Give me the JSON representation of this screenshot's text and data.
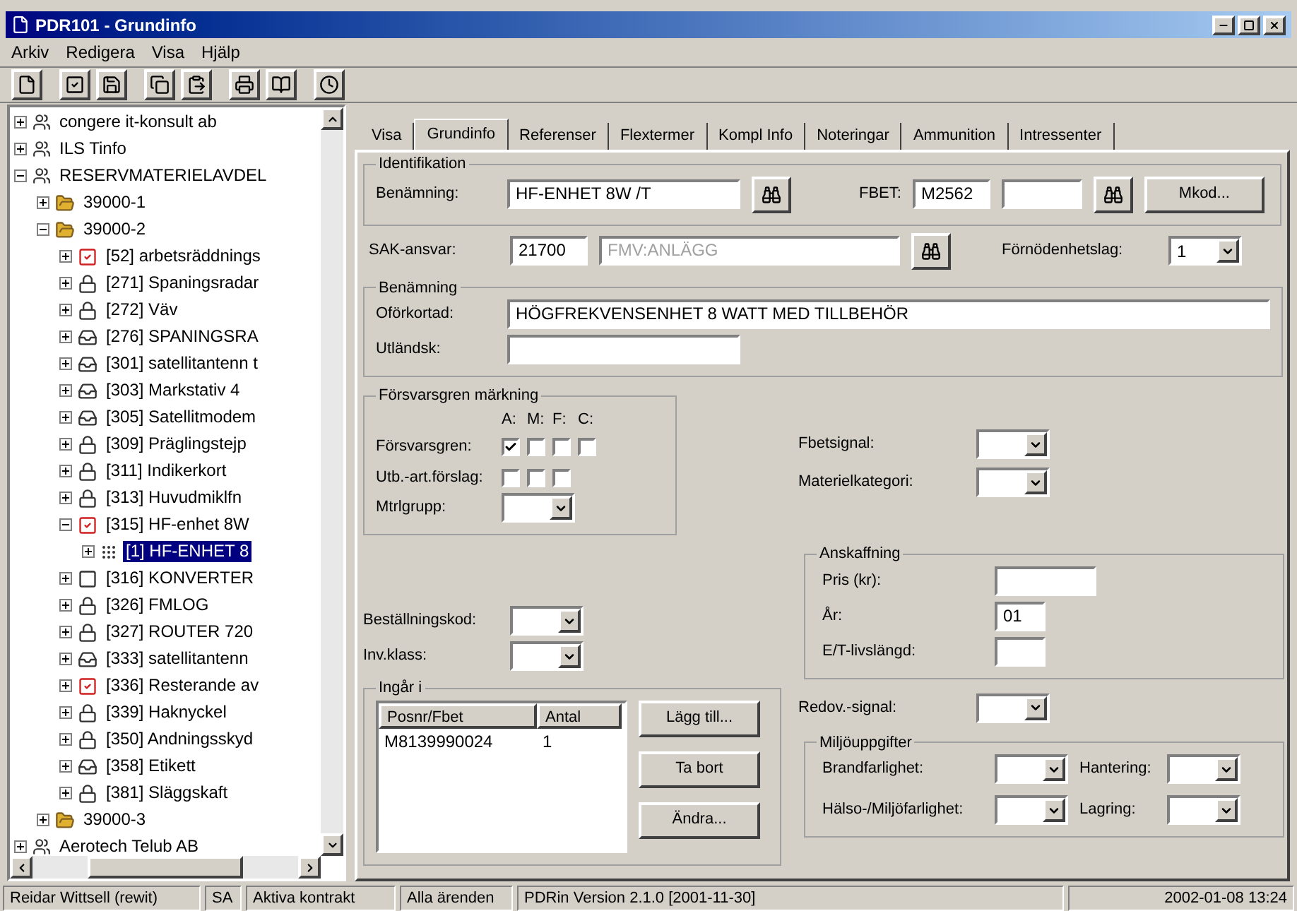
{
  "window": {
    "title": "PDR101 - Grundinfo"
  },
  "menu": [
    "Arkiv",
    "Redigera",
    "Visa",
    "Hjälp"
  ],
  "tree": [
    {
      "label": "congere it-konsult ab",
      "kind": "org",
      "expanded": false,
      "selected": false
    },
    {
      "label": "ILS Tinfo",
      "kind": "org",
      "expanded": false,
      "selected": false
    },
    {
      "label": "RESERVMATERIELAVDEL",
      "kind": "org",
      "expanded": true,
      "selected": false,
      "children": [
        {
          "label": "39000-1",
          "kind": "folder",
          "expanded": false,
          "selected": false
        },
        {
          "label": "39000-2",
          "kind": "folder",
          "expanded": true,
          "selected": false,
          "children": [
            {
              "label": "[52] arbetsräddnings",
              "kind": "check",
              "expanded": false,
              "selected": false
            },
            {
              "label": "[271] Spaningsradar",
              "kind": "lock",
              "expanded": false,
              "selected": false
            },
            {
              "label": "[272] Väv",
              "kind": "lock",
              "expanded": false,
              "selected": false
            },
            {
              "label": "[276] SPANINGSRA",
              "kind": "tray",
              "expanded": false,
              "selected": false
            },
            {
              "label": "[301] satellitantenn t",
              "kind": "tray",
              "expanded": false,
              "selected": false
            },
            {
              "label": "[303] Markstativ 4",
              "kind": "tray",
              "expanded": false,
              "selected": false
            },
            {
              "label": "[305] Satellitmodem",
              "kind": "tray",
              "expanded": false,
              "selected": false
            },
            {
              "label": "[309] Präglingstejp",
              "kind": "lock",
              "expanded": false,
              "selected": false
            },
            {
              "label": "[311] Indikerkort",
              "kind": "lock",
              "expanded": false,
              "selected": false
            },
            {
              "label": "[313] Huvudmiklfn",
              "kind": "lock",
              "expanded": false,
              "selected": false
            },
            {
              "label": "[315] HF-enhet 8W",
              "kind": "check",
              "expanded": true,
              "selected": false,
              "children": [
                {
                  "label": "[1] HF-ENHET 8",
                  "kind": "item",
                  "expanded": false,
                  "selected": true
                }
              ]
            },
            {
              "label": "[316] KONVERTER",
              "kind": "blank",
              "expanded": false,
              "selected": false
            },
            {
              "label": "[326] FMLOG",
              "kind": "lock",
              "expanded": false,
              "selected": false
            },
            {
              "label": "[327] ROUTER 720",
              "kind": "lock",
              "expanded": false,
              "selected": false
            },
            {
              "label": "[333] satellitantenn",
              "kind": "tray",
              "expanded": false,
              "selected": false
            },
            {
              "label": "[336] Resterande av",
              "kind": "check",
              "expanded": false,
              "selected": false
            },
            {
              "label": "[339] Haknyckel",
              "kind": "lock",
              "expanded": false,
              "selected": false
            },
            {
              "label": "[350] Andningsskyd",
              "kind": "lock",
              "expanded": false,
              "selected": false
            },
            {
              "label": "[358] Etikett",
              "kind": "tray",
              "expanded": false,
              "selected": false
            },
            {
              "label": "[381] Släggskaft",
              "kind": "lock",
              "expanded": false,
              "selected": false
            }
          ]
        },
        {
          "label": "39000-3",
          "kind": "folder",
          "expanded": false,
          "selected": false
        }
      ]
    },
    {
      "label": "Aerotech Telub AB",
      "kind": "org",
      "expanded": false,
      "selected": false
    }
  ],
  "tabs": [
    {
      "label": "Visa",
      "selected": false
    },
    {
      "label": "Grundinfo",
      "selected": true
    },
    {
      "label": "Referenser",
      "selected": false
    },
    {
      "label": "Flextermer",
      "selected": false
    },
    {
      "label": "Kompl Info",
      "selected": false
    },
    {
      "label": "Noteringar",
      "selected": false
    },
    {
      "label": "Ammunition",
      "selected": false
    },
    {
      "label": "Intressenter",
      "selected": false
    }
  ],
  "identification": {
    "legend": "Identifikation",
    "name_label": "Benämning:",
    "name_value": "HF-ENHET 8W /T",
    "fbet_label": "FBET:",
    "fbet_value": "M2562",
    "mkod_button": "Mkod..."
  },
  "sak": {
    "label": "SAK-ansvar:",
    "code": "21700",
    "name": "FMV:ANLÄGG",
    "name_disabled": true,
    "class_label": "Förnödenhetslag:",
    "class_value": "1"
  },
  "naming": {
    "legend": "Benämning",
    "full_label": "Oförkortad:",
    "full_value": "HÖGFREKVENSENHET 8 WATT MED TILLBEHÖR",
    "foreign_label": "Utländsk:"
  },
  "branch": {
    "legend": "Försvarsgren märkning",
    "columns": [
      "A:",
      "M:",
      "F:",
      "C:"
    ],
    "rows": [
      {
        "label": "Försvarsgren:",
        "boxes": [
          {
            "checked": true
          },
          {
            "checked": false
          },
          {
            "checked": false
          },
          {
            "checked": false
          }
        ]
      },
      {
        "label": "Utb.-art.förslag:",
        "boxes": [
          {
            "checked": false
          },
          {
            "checked": false
          },
          {
            "checked": false
          }
        ]
      }
    ],
    "group_label": "Mtrlgrupp:"
  },
  "left_dropdowns": [
    "Beställningskod:",
    "Inv.klass:"
  ],
  "right_dropdowns": [
    "Fbetsignal:",
    "Materielkategori:"
  ],
  "procurement": {
    "legend": "Anskaffning",
    "price_label": "Pris (kr):",
    "year_label": "År:",
    "year_value": "01",
    "life_label": "E/T-livslängd:"
  },
  "included": {
    "legend": "Ingår i",
    "columns": [
      "Posnr/Fbet",
      "Antal"
    ],
    "rows": [
      [
        "M8139990024",
        "1"
      ]
    ],
    "buttons": [
      "Lägg till...",
      "Ta bort",
      "Ändra..."
    ]
  },
  "report_signal": "Redov.-signal:",
  "environment": {
    "legend": "Miljöuppgifter",
    "fields": [
      "Brandfarlighet:",
      "Hantering:",
      "Hälso-/Miljöfarlighet:",
      "Lagring:"
    ]
  },
  "status_bar": [
    "Reidar Wittsell (rewit)",
    "SA",
    "Aktiva kontrakt",
    "Alla ärenden",
    "PDRin Version 2.1.0 [2001-11-30]",
    "2002-01-08 13:24"
  ]
}
